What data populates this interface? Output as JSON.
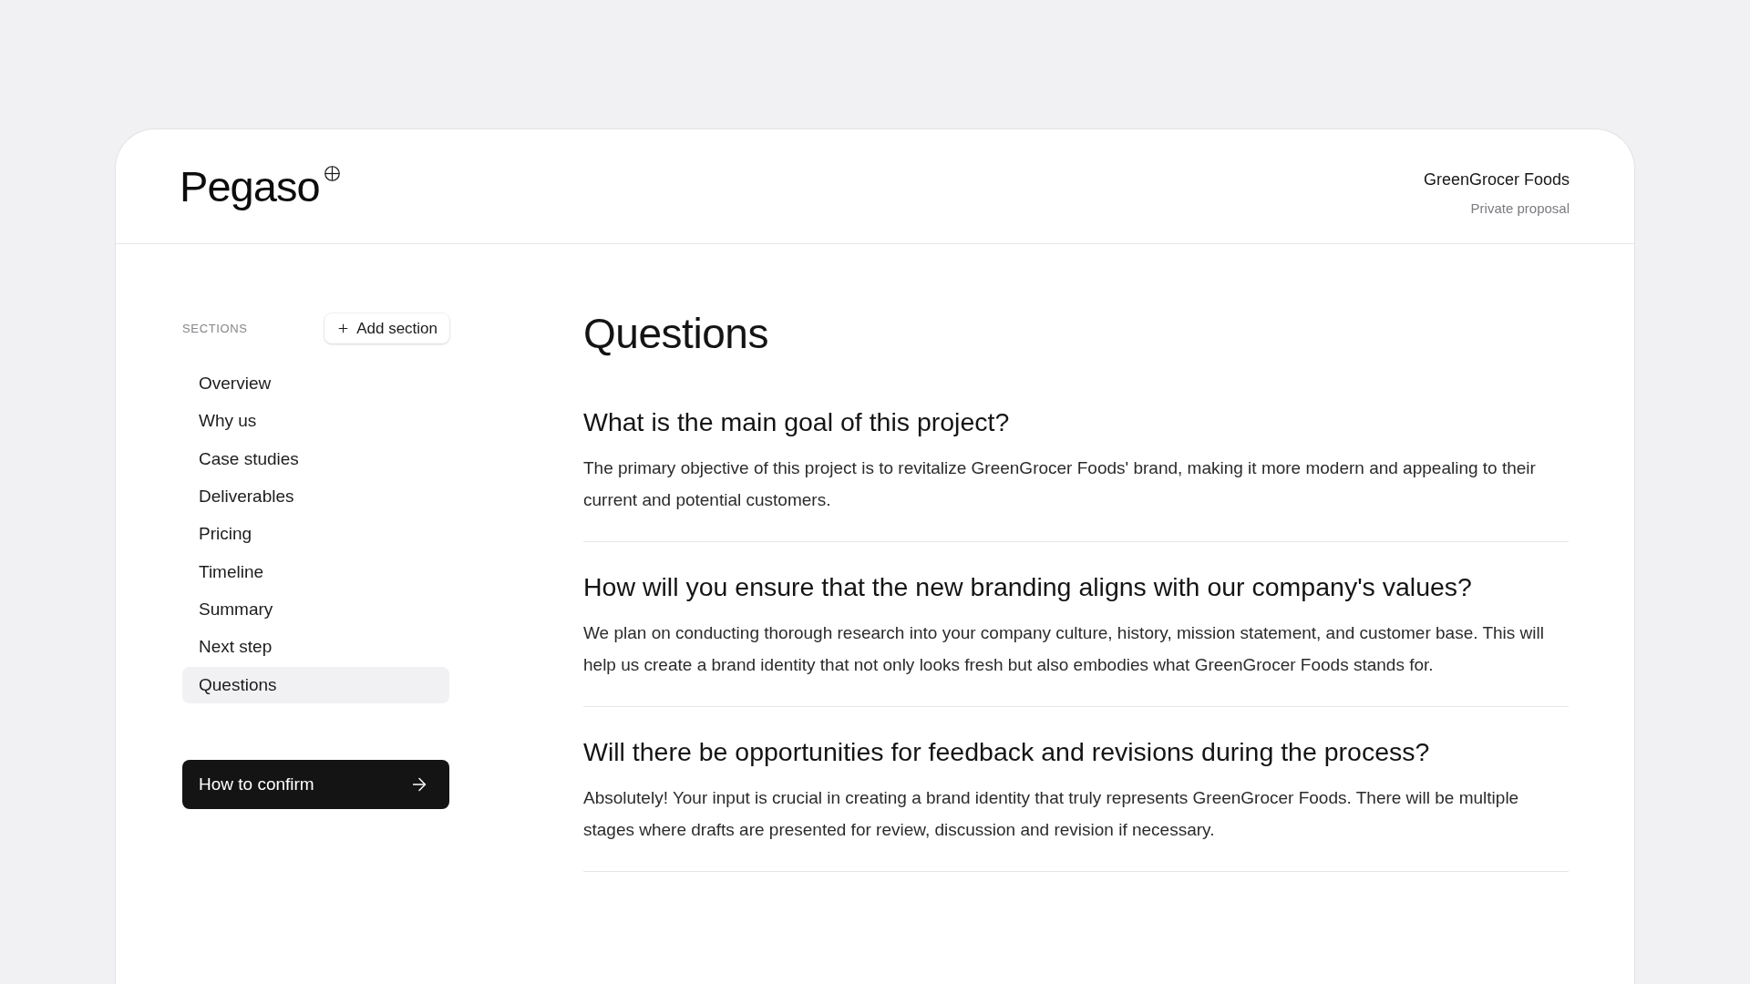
{
  "header": {
    "logo": "Pegaso",
    "client": "GreenGrocer Foods",
    "subtitle": "Private proposal"
  },
  "sidebar": {
    "heading": "SECTIONS",
    "add_button": "Add section",
    "items": [
      {
        "label": "Overview",
        "selected": false
      },
      {
        "label": "Why us",
        "selected": false
      },
      {
        "label": "Case studies",
        "selected": false
      },
      {
        "label": "Deliverables",
        "selected": false
      },
      {
        "label": "Pricing",
        "selected": false
      },
      {
        "label": "Timeline",
        "selected": false
      },
      {
        "label": "Summary",
        "selected": false
      },
      {
        "label": "Next step",
        "selected": false
      },
      {
        "label": "Questions",
        "selected": true
      }
    ],
    "cta": "How to confirm"
  },
  "main": {
    "title": "Questions",
    "questions": [
      {
        "question": "What is the main goal of this project?",
        "answer": "The primary objective of this project is to revitalize GreenGrocer Foods' brand, making it more modern and appealing to their current and potential customers."
      },
      {
        "question": "How will you ensure that the new branding aligns with our company's values?",
        "answer": "We plan on conducting thorough research into your company culture, history, mission statement, and customer base. This will help us create a brand identity that not only looks fresh but also embodies what GreenGrocer Foods stands for."
      },
      {
        "question": "Will there be opportunities for feedback and revisions during the process?",
        "answer": "Absolutely! Your input is crucial in creating a brand identity that truly represents GreenGrocer Foods. There will be multiple stages where drafts are presented for review, discussion and revision if necessary."
      }
    ]
  }
}
